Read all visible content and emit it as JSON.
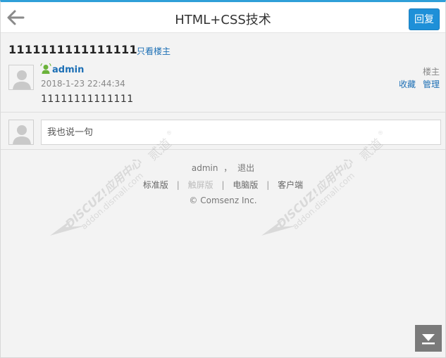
{
  "header": {
    "title": "HTML+CSS技术",
    "reply_label": "回复"
  },
  "post": {
    "thread_title": "1111111111111111",
    "only_op_label": "只看楼主",
    "author": "admin",
    "time": "2018-1-23 22:44:34",
    "content": "11111111111111",
    "floor_label": "楼主",
    "favorite_label": "收藏",
    "manage_label": "管理"
  },
  "reply": {
    "placeholder": "我也说一句"
  },
  "footer": {
    "user": "admin",
    "comma": "，",
    "logout": "退出",
    "standard": "标准版",
    "touch": "触屏版",
    "desktop": "电脑版",
    "client": "客户端",
    "copyright": "© Comsenz Inc."
  },
  "watermark": {
    "line1": "DISCUZ!应用中心",
    "line2": "addon.dismall.com",
    "line3": "贰道",
    "registered": "®"
  },
  "colors": {
    "accent": "#2f9fd8",
    "button": "#1e90d8",
    "link": "#1c6fb5",
    "scroll_button": "#7a7a7a"
  },
  "icons": {
    "back": "arrow-left-icon",
    "online": "online-user-icon",
    "avatar": "default-avatar-icon",
    "scroll": "scroll-to-bottom-icon"
  }
}
